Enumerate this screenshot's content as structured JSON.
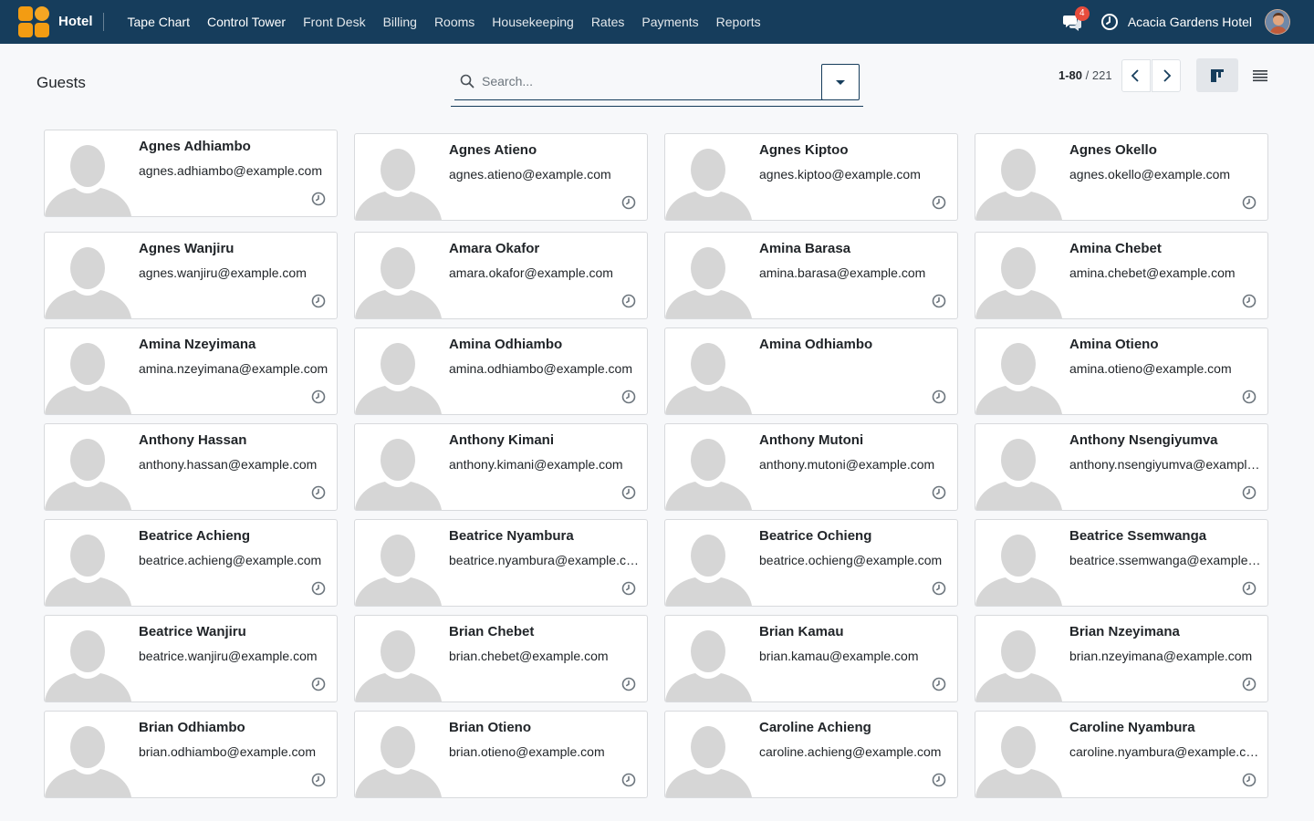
{
  "navbar": {
    "app_name": "Hotel",
    "menu": [
      {
        "label": "Tape Chart",
        "active": true
      },
      {
        "label": "Control Tower",
        "active": true
      },
      {
        "label": "Front Desk",
        "active": false
      },
      {
        "label": "Billing",
        "active": false
      },
      {
        "label": "Rooms",
        "active": false
      },
      {
        "label": "Housekeeping",
        "active": false
      },
      {
        "label": "Rates",
        "active": false
      },
      {
        "label": "Payments",
        "active": false
      },
      {
        "label": "Reports",
        "active": false
      }
    ],
    "chat_count": "4",
    "company": "Acacia Gardens Hotel",
    "icons": {
      "chat": "chat-icon",
      "clock": "clock-icon",
      "avatar": "user-avatar"
    }
  },
  "control_panel": {
    "title": "Guests",
    "search_placeholder": "Search...",
    "pager_range": "1-80",
    "pager_total": "221",
    "view_modes": [
      "kanban-view-icon",
      "list-view-icon"
    ],
    "active_view": "kanban"
  },
  "colors": {
    "navbar": "#163d5c",
    "accent": "#f39c12",
    "badge": "#e74c3c",
    "background": "#f7f8fa"
  },
  "guests": [
    {
      "name": "Agnes Adhiambo",
      "email": "agnes.adhiambo@example.com"
    },
    {
      "name": "Agnes Atieno",
      "email": "agnes.atieno@example.com"
    },
    {
      "name": "Agnes Kiptoo",
      "email": "agnes.kiptoo@example.com"
    },
    {
      "name": "Agnes Okello",
      "email": "agnes.okello@example.com"
    },
    {
      "name": "Agnes Wanjiru",
      "email": "agnes.wanjiru@example.com"
    },
    {
      "name": "Amara Okafor",
      "email": "amara.okafor@example.com"
    },
    {
      "name": "Amina Barasa",
      "email": "amina.barasa@example.com"
    },
    {
      "name": "Amina Chebet",
      "email": "amina.chebet@example.com"
    },
    {
      "name": "Amina Nzeyimana",
      "email": "amina.nzeyimana@example.com"
    },
    {
      "name": "Amina Odhiambo",
      "email": "amina.odhiambo@example.com"
    },
    {
      "name": "Amina Odhiambo",
      "email": ""
    },
    {
      "name": "Amina Otieno",
      "email": "amina.otieno@example.com"
    },
    {
      "name": "Anthony Hassan",
      "email": "anthony.hassan@example.com"
    },
    {
      "name": "Anthony Kimani",
      "email": "anthony.kimani@example.com"
    },
    {
      "name": "Anthony Mutoni",
      "email": "anthony.mutoni@example.com"
    },
    {
      "name": "Anthony Nsengiyumva",
      "email": "anthony.nsengiyumva@example.com"
    },
    {
      "name": "Beatrice Achieng",
      "email": "beatrice.achieng@example.com"
    },
    {
      "name": "Beatrice Nyambura",
      "email": "beatrice.nyambura@example.com"
    },
    {
      "name": "Beatrice Ochieng",
      "email": "beatrice.ochieng@example.com"
    },
    {
      "name": "Beatrice Ssemwanga",
      "email": "beatrice.ssemwanga@example.com"
    },
    {
      "name": "Beatrice Wanjiru",
      "email": "beatrice.wanjiru@example.com"
    },
    {
      "name": "Brian Chebet",
      "email": "brian.chebet@example.com"
    },
    {
      "name": "Brian Kamau",
      "email": "brian.kamau@example.com"
    },
    {
      "name": "Brian Nzeyimana",
      "email": "brian.nzeyimana@example.com"
    },
    {
      "name": "Brian Odhiambo",
      "email": "brian.odhiambo@example.com"
    },
    {
      "name": "Brian Otieno",
      "email": "brian.otieno@example.com"
    },
    {
      "name": "Caroline Achieng",
      "email": "caroline.achieng@example.com"
    },
    {
      "name": "Caroline Nyambura",
      "email": "caroline.nyambura@example.com"
    }
  ]
}
